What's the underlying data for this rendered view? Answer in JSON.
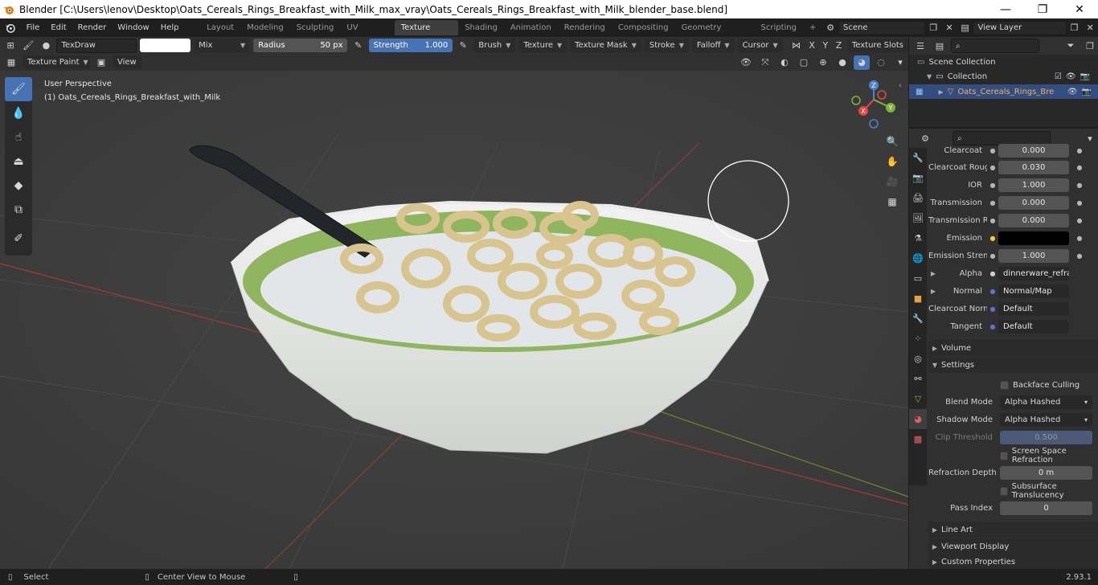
{
  "window": {
    "title": "Blender [C:\\Users\\lenov\\Desktop\\Oats_Cereals_Rings_Breakfast_with_Milk_max_vray\\Oats_Cereals_Rings_Breakfast_with_Milk_blender_base.blend]",
    "minimize": "—",
    "restore": "❐",
    "close": "✕"
  },
  "menu": [
    "File",
    "Edit",
    "Render",
    "Window",
    "Help"
  ],
  "workspaces": [
    "Layout",
    "Modeling",
    "Sculpting",
    "UV Editing",
    "Texture Paint",
    "Shading",
    "Animation",
    "Rendering",
    "Compositing",
    "Geometry Nodes",
    "Scripting"
  ],
  "workspace_add": "+",
  "scene": {
    "label": "Scene",
    "view_layer": "View Layer"
  },
  "tool_header": {
    "brush_name": "TexDraw",
    "blend": "Mix",
    "radius_label": "Radius",
    "radius_value": "50 px",
    "strength_label": "Strength",
    "strength_value": "1.000",
    "menus": [
      "Brush",
      "Texture",
      "Texture Mask",
      "Stroke",
      "Falloff",
      "Cursor"
    ],
    "axes": [
      "X",
      "Y",
      "Z"
    ],
    "texture_slots": "Texture Slots"
  },
  "mode_header": {
    "mode": "Texture Paint",
    "view": "View"
  },
  "viewport": {
    "perspective": "User Perspective",
    "object_info": "(1) Oats_Cereals_Rings_Breakfast_with_Milk",
    "gizmo": {
      "x": "X",
      "y": "Y",
      "z": "Z"
    }
  },
  "outliner": {
    "root": "Scene Collection",
    "collection": "Collection",
    "object": "Oats_Cereals_Rings_Bre"
  },
  "properties": {
    "rows": [
      {
        "label": "Clearcoat",
        "value": "0.000"
      },
      {
        "label": "Clearcoat Roug...",
        "value": "0.030"
      },
      {
        "label": "IOR",
        "value": "1.000"
      },
      {
        "label": "Transmission",
        "value": "0.000"
      },
      {
        "label": "Transmission R...",
        "value": "0.000"
      },
      {
        "label": "Emission",
        "value": ""
      },
      {
        "label": "Emission Streng...",
        "value": "1.000"
      },
      {
        "label": "Alpha",
        "value": "dinnerware_refracti..."
      },
      {
        "label": "Normal",
        "value": "Normal/Map"
      },
      {
        "label": "Clearcoat Normal",
        "value": "Default"
      },
      {
        "label": "Tangent",
        "value": "Default"
      }
    ],
    "sections": {
      "volume": "Volume",
      "settings": "Settings",
      "line_art": "Line Art",
      "viewport_display": "Viewport Display",
      "custom_properties": "Custom Properties"
    },
    "settings": {
      "backface_culling": "Backface Culling",
      "blend_mode_label": "Blend Mode",
      "blend_mode": "Alpha Hashed",
      "shadow_mode_label": "Shadow Mode",
      "shadow_mode": "Alpha Hashed",
      "clip_threshold_label": "Clip Threshold",
      "clip_threshold": "0.500",
      "screen_space_refraction": "Screen Space Refraction",
      "refraction_depth_label": "Refraction Depth",
      "refraction_depth": "0 m",
      "subsurface_translucency": "Subsurface Translucency",
      "pass_index_label": "Pass Index",
      "pass_index": "0"
    }
  },
  "status": {
    "select": "Select",
    "center_view": "Center View to Mouse",
    "version": "2.93.1"
  },
  "colors": {
    "accent": "#4772b3",
    "viewport": "#3b3b3b",
    "bowl_rim": "#8fb55e",
    "milk": "#e3e6e8",
    "cereal": "#d8c48e"
  }
}
